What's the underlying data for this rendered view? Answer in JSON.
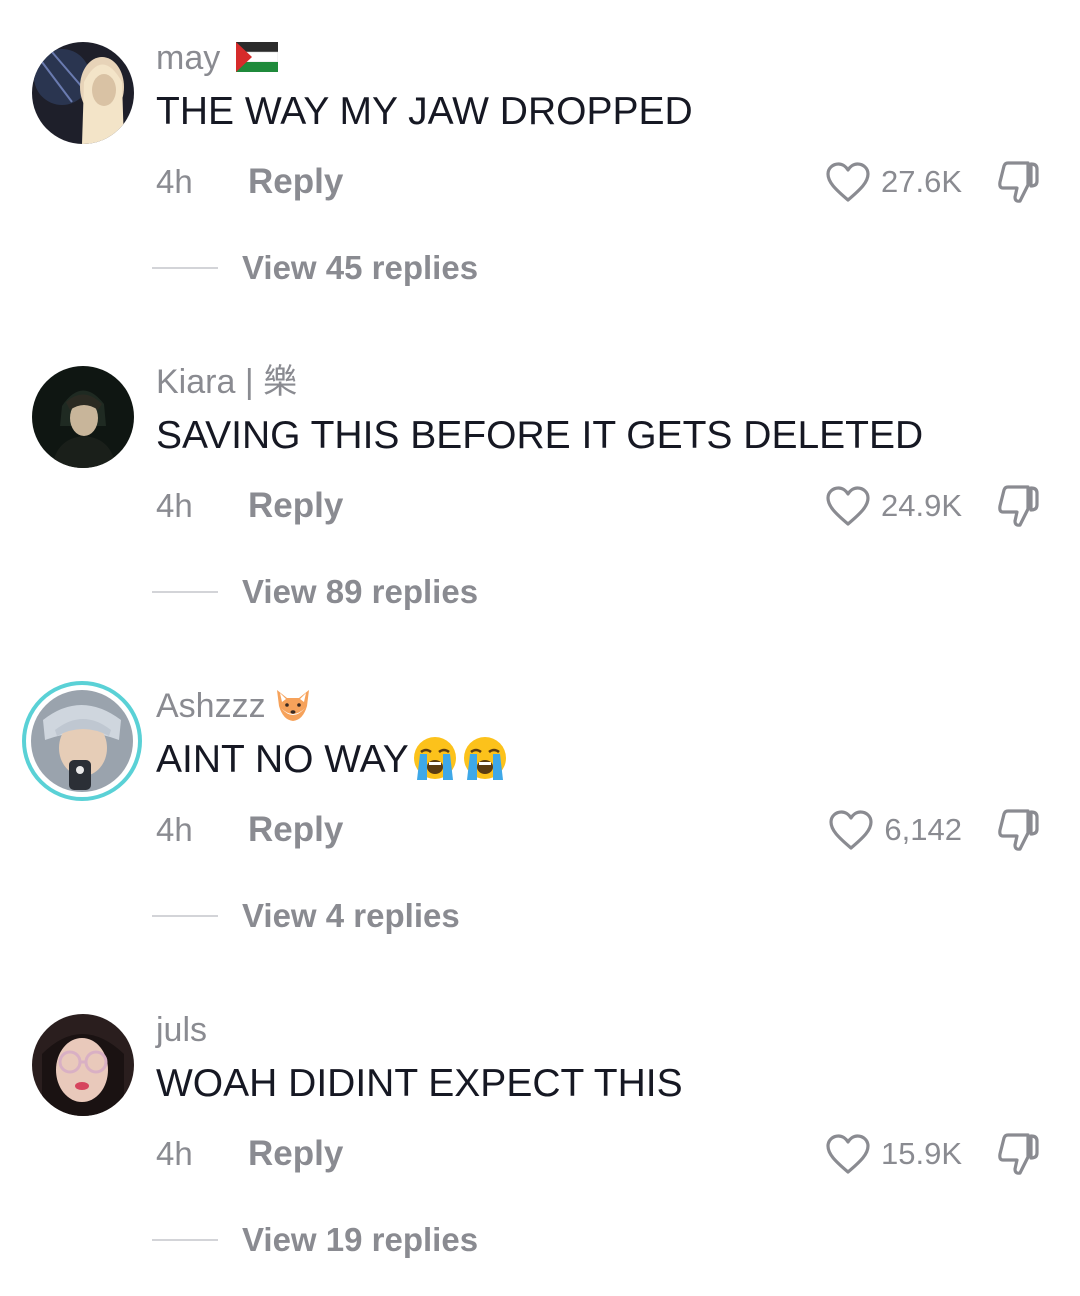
{
  "comments": [
    {
      "username": "may",
      "username_icon": "palestine-flag-icon",
      "text": "THE WAY MY JAW DROPPED",
      "time": "4h",
      "reply_label": "Reply",
      "likes": "27.6K",
      "view_replies": "View 45 replies"
    },
    {
      "username": "Kiara | 樂",
      "text": "SAVING THIS BEFORE IT GETS DELETED",
      "time": "4h",
      "reply_label": "Reply",
      "likes": "24.9K",
      "view_replies": "View 89 replies"
    },
    {
      "username": "Ashzzz",
      "username_icon": "fox-face-emoji",
      "text": "AINT NO WAY",
      "text_icons": [
        "loudly-crying-face-emoji",
        "loudly-crying-face-emoji"
      ],
      "time": "4h",
      "reply_label": "Reply",
      "likes": "6,142",
      "view_replies": "View 4 replies",
      "avatar_ring_color": "#5ad1d6"
    },
    {
      "username": "juls",
      "text": "WOAH DIDINT EXPECT THIS",
      "time": "4h",
      "reply_label": "Reply",
      "likes": "15.9K",
      "view_replies": "View 19 replies"
    }
  ],
  "colors": {
    "primary_text": "#161823",
    "secondary_text": "#8a8b91",
    "divider": "#d3d4d8",
    "background": "#ffffff"
  },
  "icons": {
    "like": "heart-outline-icon",
    "dislike": "thumbs-down-outline-icon"
  }
}
